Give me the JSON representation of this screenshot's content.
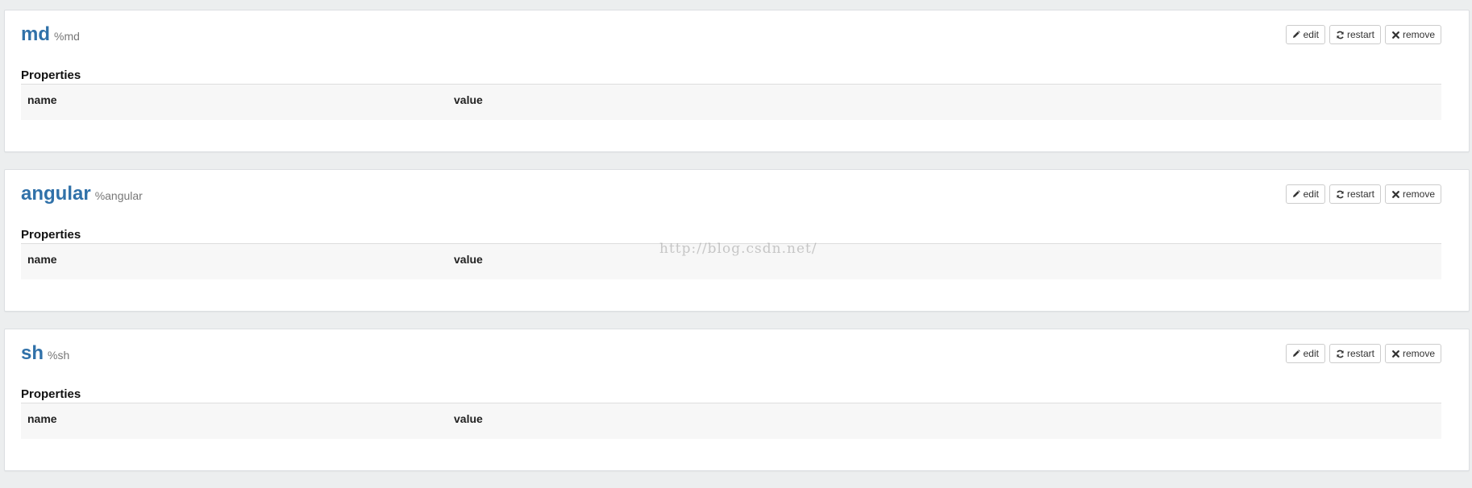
{
  "interpreters": [
    {
      "name": "md",
      "group": "%md",
      "buttons": {
        "edit": "edit",
        "restart": "restart",
        "remove": "remove"
      },
      "properties_heading": "Properties",
      "columns": [
        "name",
        "value"
      ]
    },
    {
      "name": "angular",
      "group": "%angular",
      "buttons": {
        "edit": "edit",
        "restart": "restart",
        "remove": "remove"
      },
      "properties_heading": "Properties",
      "columns": [
        "name",
        "value"
      ]
    },
    {
      "name": "sh",
      "group": "%sh",
      "buttons": {
        "edit": "edit",
        "restart": "restart",
        "remove": "remove"
      },
      "properties_heading": "Properties",
      "columns": [
        "name",
        "value"
      ]
    }
  ],
  "icons": {
    "edit": "pencil-icon",
    "restart": "refresh-icon",
    "remove": "times-icon"
  },
  "colors": {
    "page_background": "#eceeef",
    "interpreter_name": "#3071a9",
    "group_text": "#777777",
    "table_header_background": "#f7f7f7"
  },
  "watermark": "http://blog.csdn.net/"
}
